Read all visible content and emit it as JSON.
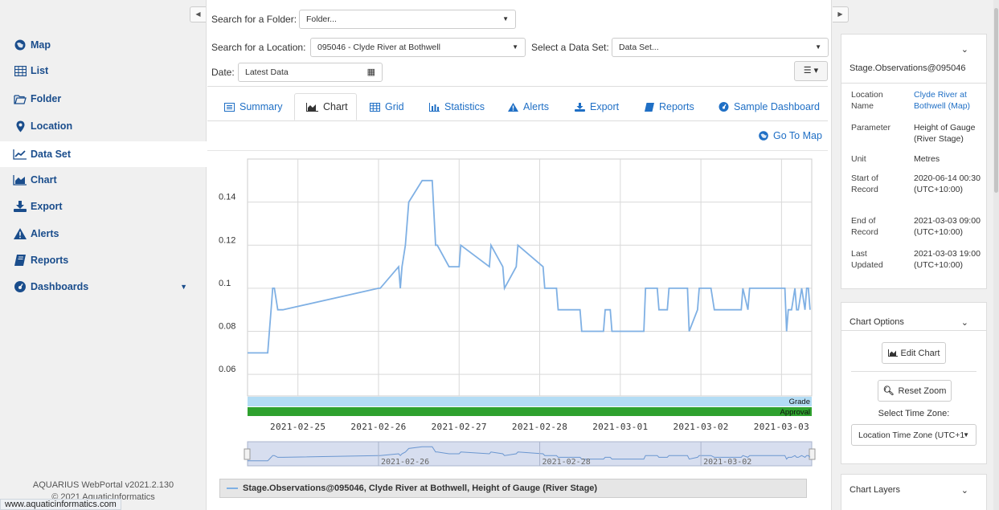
{
  "sidebar": {
    "items": [
      {
        "label": "Map",
        "icon": "globe-icon"
      },
      {
        "label": "List",
        "icon": "table-icon"
      },
      {
        "label": "Folder",
        "icon": "folder-icon"
      },
      {
        "label": "Location",
        "icon": "map-marker-icon"
      },
      {
        "label": "Data Set",
        "icon": "line-chart-icon"
      },
      {
        "label": "Chart",
        "icon": "area-chart-icon"
      },
      {
        "label": "Export",
        "icon": "download-icon"
      },
      {
        "label": "Alerts",
        "icon": "warning-icon"
      },
      {
        "label": "Reports",
        "icon": "book-icon"
      },
      {
        "label": "Dashboards",
        "icon": "dashboard-icon"
      }
    ],
    "active": "Data Set",
    "footer_version": "AQUARIUS WebPortal v2021.2.130",
    "footer_copyright": "© 2021 AquaticInformatics"
  },
  "status_url": "www.aquaticinformatics.com",
  "controls": {
    "folder_label": "Search for a Folder:",
    "folder_value": "Folder...",
    "location_label": "Search for a Location:",
    "location_value": "095046 - Clyde River at Bothwell",
    "dataset_label": "Select a Data Set:",
    "dataset_value": "Data Set...",
    "date_label": "Date:",
    "date_value": "Latest Data"
  },
  "tabs": [
    {
      "label": "Summary",
      "icon": "list-icon"
    },
    {
      "label": "Chart",
      "icon": "area-chart-icon"
    },
    {
      "label": "Grid",
      "icon": "grid-icon"
    },
    {
      "label": "Statistics",
      "icon": "bar-chart-icon"
    },
    {
      "label": "Alerts",
      "icon": "warning-icon"
    },
    {
      "label": "Export",
      "icon": "download-icon"
    },
    {
      "label": "Reports",
      "icon": "book-icon"
    },
    {
      "label": "Sample Dashboard",
      "icon": "dashboard-icon"
    }
  ],
  "active_tab": "Chart",
  "go_to_map": "Go To Map",
  "legend_text": "Stage.Observations@095046, Clyde River at Bothwell, Height of Gauge (River Stage)",
  "chart_data": {
    "type": "line",
    "xlabel": "",
    "ylabel": "",
    "yticks": [
      "0.06",
      "0.08",
      "0.1",
      "0.12",
      "0.14"
    ],
    "xticks": [
      "2021-02-25",
      "2021-02-26",
      "2021-02-27",
      "2021-02-28",
      "2021-03-01",
      "2021-03-02",
      "2021-03-03"
    ],
    "ylim": [
      0.05,
      0.16
    ],
    "xlim": [
      "2021-02-24 09:00",
      "2021-03-03 09:00"
    ],
    "band_labels": [
      "Grade",
      "Approval"
    ],
    "colors": {
      "line": "#7fb0e4",
      "grade": "#b3dcf4",
      "approval": "#2ea12e"
    },
    "navigator_ticks": [
      "2021-02-26",
      "2021-02-28",
      "2021-03-02"
    ],
    "series": [
      {
        "name": "Stage.Observations@095046",
        "x_hours": [
          0,
          6,
          6.5,
          7,
          7.5,
          8,
          9,
          10,
          10.5,
          39,
          39.5,
          45,
          45.5,
          46,
          47,
          47.5,
          48,
          52,
          52.5,
          55,
          56,
          56.5,
          60,
          63,
          63.5,
          72,
          72.5,
          76,
          76.5,
          80,
          80.5,
          88,
          88.5,
          92,
          92.5,
          99,
          99.5,
          106,
          106.5,
          108,
          108.5,
          118,
          118.5,
          122,
          122.5,
          125,
          125.5,
          129,
          129.5,
          131,
          131.5,
          134,
          134.5,
          138,
          139,
          147,
          147.5,
          149,
          149.5,
          155,
          155.5,
          160,
          160.5,
          161,
          162,
          163,
          163.5,
          164,
          165,
          166,
          166.5,
          167,
          167.5
        ],
        "values": [
          0.07,
          0.07,
          0.08,
          0.09,
          0.1,
          0.1,
          0.09,
          0.09,
          0.09,
          0.1,
          0.1,
          0.11,
          0.1,
          0.11,
          0.12,
          0.13,
          0.14,
          0.15,
          0.15,
          0.15,
          0.12,
          0.12,
          0.11,
          0.11,
          0.12,
          0.11,
          0.12,
          0.11,
          0.1,
          0.11,
          0.12,
          0.11,
          0.1,
          0.1,
          0.09,
          0.09,
          0.08,
          0.08,
          0.09,
          0.09,
          0.08,
          0.08,
          0.1,
          0.1,
          0.09,
          0.09,
          0.1,
          0.1,
          0.1,
          0.1,
          0.08,
          0.09,
          0.1,
          0.1,
          0.09,
          0.09,
          0.1,
          0.09,
          0.1,
          0.1,
          0.1,
          0.1,
          0.08,
          0.09,
          0.09,
          0.1,
          0.09,
          0.09,
          0.1,
          0.09,
          0.1,
          0.1,
          0.09
        ]
      }
    ]
  },
  "info_card": {
    "title": "Stage.Observations@095046",
    "rows": [
      {
        "k": "Location Name",
        "v": "Clyde River at Bothwell (Map)"
      },
      {
        "k": "Parameter",
        "v": "Height of Gauge (River Stage)"
      },
      {
        "k": "Unit",
        "v": "Metres"
      },
      {
        "k": "Start of Record",
        "v": "2020-06-14 00:30 (UTC+10:00)"
      },
      {
        "k": "End of Record",
        "v": "2021-03-03 09:00 (UTC+10:00)"
      },
      {
        "k": "Last Updated",
        "v": "2021-03-03 19:00 (UTC+10:00)"
      }
    ]
  },
  "chart_options": {
    "title": "Chart Options",
    "edit_chart": "Edit Chart",
    "reset_zoom": "Reset Zoom",
    "timezone_label": "Select Time Zone:",
    "timezone_value": "Location Time Zone (UTC+1"
  },
  "chart_layers": {
    "title": "Chart Layers"
  }
}
